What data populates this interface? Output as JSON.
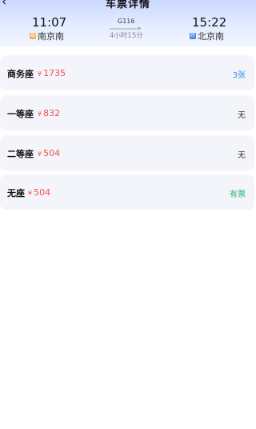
{
  "header": {
    "title": "车票详情",
    "back_icon": "chevron-left-icon"
  },
  "trip": {
    "departure": {
      "time": "11:07",
      "station": "南京南",
      "badge": "始"
    },
    "arrival": {
      "time": "15:22",
      "station": "北京南",
      "badge": "终"
    },
    "train_no": "G116",
    "duration": "4小时15分"
  },
  "seats": [
    {
      "name": "商务座",
      "currency": "¥",
      "price": "1735",
      "availability": "3张",
      "availability_color": "#3a8ee6"
    },
    {
      "name": "一等座",
      "currency": "¥",
      "price": "832",
      "availability": "无",
      "availability_color": "#333333"
    },
    {
      "name": "二等座",
      "currency": "¥",
      "price": "504",
      "availability": "无",
      "availability_color": "#333333"
    },
    {
      "name": "无座",
      "currency": "¥",
      "price": "504",
      "availability": "有票",
      "availability_color": "#2fb36a"
    }
  ],
  "colors": {
    "price": "#f0524f",
    "header_gradient_top": "#c9d8ff",
    "card_bg": "#f3f5fa"
  }
}
